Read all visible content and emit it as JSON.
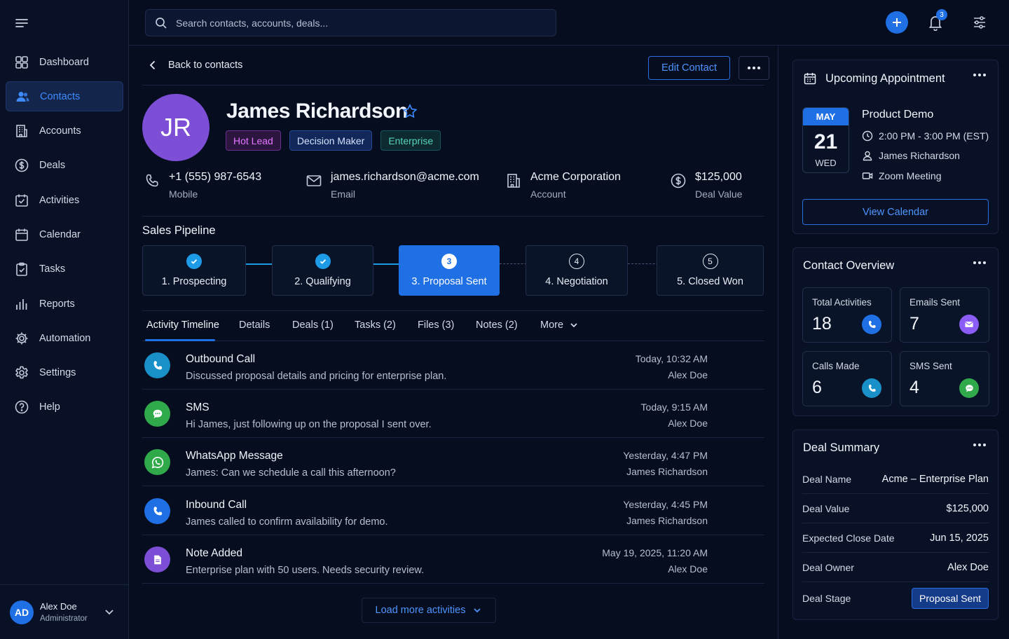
{
  "sidebar": {
    "items": [
      {
        "label": "Dashboard"
      },
      {
        "label": "Contacts"
      },
      {
        "label": "Accounts"
      },
      {
        "label": "Deals"
      },
      {
        "label": "Activities"
      },
      {
        "label": "Calendar"
      },
      {
        "label": "Tasks"
      },
      {
        "label": "Reports"
      },
      {
        "label": "Automation"
      },
      {
        "label": "Settings"
      },
      {
        "label": "Help"
      }
    ],
    "active_index": 1,
    "user": {
      "initials": "AD",
      "name": "Alex Doe",
      "role": "Administrator"
    }
  },
  "topbar": {
    "search_placeholder": "Search contacts, accounts, deals...",
    "notification_count": "3"
  },
  "header": {
    "back_label": "Back to contacts",
    "edit_label": "Edit Contact"
  },
  "contact": {
    "initials": "JR",
    "name": "James Richardson",
    "tags": [
      "Hot Lead",
      "Decision Maker",
      "Enterprise"
    ],
    "phone": {
      "value": "+1 (555) 987-6543",
      "label": "Mobile"
    },
    "email": {
      "value": "james.richardson@acme.com",
      "label": "Email"
    },
    "account": {
      "value": "Acme Corporation",
      "label": "Account"
    },
    "deal": {
      "value": "$125,000",
      "label": "Deal Value"
    }
  },
  "pipeline": {
    "title": "Sales Pipeline",
    "stages": [
      {
        "label": "1. Prospecting",
        "state": "done",
        "num": "1"
      },
      {
        "label": "2. Qualifying",
        "state": "done",
        "num": "2"
      },
      {
        "label": "3. Proposal Sent",
        "state": "current",
        "num": "3"
      },
      {
        "label": "4. Negotiation",
        "state": "todo",
        "num": "4"
      },
      {
        "label": "5. Closed Won",
        "state": "todo",
        "num": "5"
      }
    ]
  },
  "tabs": [
    "Activity Timeline",
    "Details",
    "Deals (1)",
    "Tasks (2)",
    "Files (3)",
    "Notes (2)",
    "More"
  ],
  "activities": [
    {
      "type": "call-out",
      "title": "Outbound Call",
      "desc": "Discussed proposal details and pricing for enterprise plan.",
      "time": "Today, 10:32 AM",
      "who": "Alex Doe",
      "color": "#1a90c9"
    },
    {
      "type": "sms",
      "title": "SMS",
      "desc": "Hi James, just following up on the proposal I sent over.",
      "time": "Today, 9:15 AM",
      "who": "Alex Doe",
      "color": "#2fa94a"
    },
    {
      "type": "whatsapp",
      "title": "WhatsApp Message",
      "desc": "James: Can we schedule a call this afternoon?",
      "time": "Yesterday, 4:47 PM",
      "who": "James Richardson",
      "color": "#2fa94a"
    },
    {
      "type": "call-in",
      "title": "Inbound Call",
      "desc": "James called to confirm availability for demo.",
      "time": "Yesterday, 4:45 PM",
      "who": "James Richardson",
      "color": "#1f6fe5"
    },
    {
      "type": "note",
      "title": "Note Added",
      "desc": "Enterprise plan with 50 users. Needs security review.",
      "time": "May 19, 2025, 11:20 AM",
      "who": "Alex Doe",
      "color": "#7c4fd6"
    }
  ],
  "load_more_label": "Load more activities",
  "appointment": {
    "panel_title": "Upcoming Appointment",
    "month": "MAY",
    "day": "21",
    "weekday": "WED",
    "title": "Product Demo",
    "time": "2:00 PM - 3:00 PM (EST)",
    "attendee": "James Richardson",
    "location": "Zoom Meeting",
    "button": "View Calendar"
  },
  "overview": {
    "panel_title": "Contact Overview",
    "stats": [
      {
        "label": "Total Activities",
        "value": "18",
        "color": "#1f6fe5"
      },
      {
        "label": "Emails Sent",
        "value": "7",
        "color": "#8b5cf6"
      },
      {
        "label": "Calls Made",
        "value": "6",
        "color": "#1a90c9"
      },
      {
        "label": "SMS Sent",
        "value": "4",
        "color": "#2fa94a"
      }
    ]
  },
  "deal_summary": {
    "panel_title": "Deal Summary",
    "rows": [
      {
        "k": "Deal Name",
        "v": "Acme – Enterprise Plan"
      },
      {
        "k": "Deal Value",
        "v": "$125,000"
      },
      {
        "k": "Expected Close Date",
        "v": "Jun 15, 2025"
      },
      {
        "k": "Deal Owner",
        "v": "Alex Doe"
      },
      {
        "k": "Deal Stage",
        "v": "Proposal Sent"
      }
    ]
  }
}
